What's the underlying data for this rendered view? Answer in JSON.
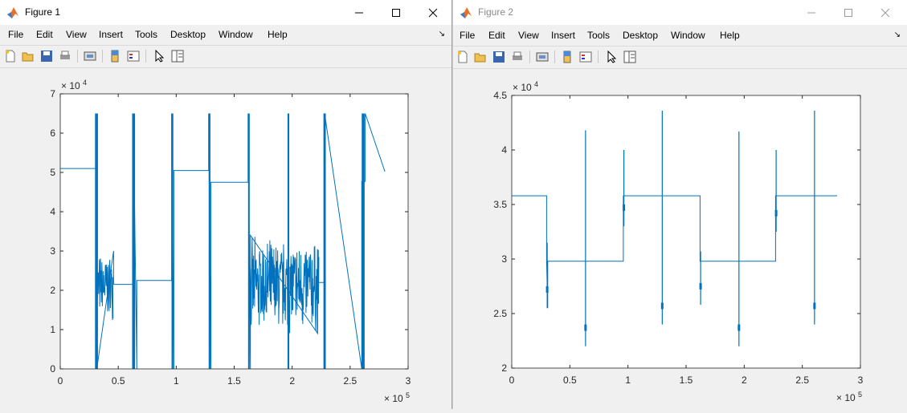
{
  "accent_color": "#0072bd",
  "menu_labels": [
    "File",
    "Edit",
    "View",
    "Insert",
    "Tools",
    "Desktop",
    "Window",
    "Help"
  ],
  "windows": [
    {
      "title": "Figure 1",
      "active": true,
      "chart_data": {
        "type": "line",
        "title": "",
        "xlabel": "",
        "ylabel": "",
        "xlim": [
          0,
          300000
        ],
        "ylim": [
          0,
          70000
        ],
        "x_exponent_label": "10",
        "x_exponent": "5",
        "y_exponent_label": "10",
        "y_exponent": "4",
        "xticks": [
          "0",
          "0.5",
          "1",
          "1.5",
          "2",
          "2.5",
          "3"
        ],
        "yticks": [
          "0",
          "1",
          "2",
          "3",
          "4",
          "5",
          "6",
          "7"
        ],
        "grid": false,
        "series": [
          {
            "x": [
              0,
              31000,
              31000,
              31500,
              46000,
              46000,
              46500,
              63000,
              63000,
              66000,
              66000,
              96000,
              96000,
              98000,
              98000,
              128000,
              128000,
              130000,
              130000,
              162000,
              162000,
              164000,
              164000,
              222000,
              222000,
              228000,
              228000,
              260000,
              260000,
              263000,
              263000,
              280000
            ],
            "y": [
              51000,
              51000,
              65000,
              0,
              30000,
              21500,
              21500,
              21500,
              65000,
              0,
              22500,
              22500,
              65000,
              0,
              50500,
              50500,
              65000,
              0,
              47500,
              47500,
              65000,
              0,
              34000,
              9000,
              22000,
              22000,
              65000,
              0,
              47700,
              47700,
              65000,
              50200
            ]
          }
        ]
      }
    },
    {
      "title": "Figure 2",
      "active": false,
      "chart_data": {
        "type": "line",
        "title": "",
        "xlabel": "",
        "ylabel": "",
        "xlim": [
          0,
          300000
        ],
        "ylim": [
          20000,
          45000
        ],
        "x_exponent_label": "10",
        "x_exponent": "5",
        "y_exponent_label": "10",
        "y_exponent": "4",
        "xticks": [
          "0",
          "0.5",
          "1",
          "1.5",
          "2",
          "2.5",
          "3"
        ],
        "yticks": [
          "2",
          "2.5",
          "3",
          "3.5",
          "4",
          "4.5"
        ],
        "grid": false,
        "series": [
          {
            "x": [
              0,
              30000,
              30000,
              31000,
              31000,
              62000,
              62000,
              96000,
              96000,
              129000,
              129000,
              162000,
              162000,
              196000,
              196000,
              227000,
              227000,
              261000,
              261000,
              280000
            ],
            "y": [
              35800,
              35800,
              29800,
              25500,
              29800,
              29800,
              29800,
              29800,
              35800,
              35800,
              35800,
              35800,
              29800,
              29800,
              29800,
              29800,
              35800,
              35800,
              35800,
              35800
            ]
          }
        ],
        "spikes": [
          {
            "x": 30500,
            "y_low": 25500,
            "y_high": 31500
          },
          {
            "x": 63500,
            "y_low": 22000,
            "y_high": 41800
          },
          {
            "x": 96500,
            "y_low": 33000,
            "y_high": 40000
          },
          {
            "x": 129500,
            "y_low": 24000,
            "y_high": 43600
          },
          {
            "x": 162500,
            "y_low": 25800,
            "y_high": 30700
          },
          {
            "x": 195500,
            "y_low": 22000,
            "y_high": 41700
          },
          {
            "x": 227500,
            "y_low": 32500,
            "y_high": 40000
          },
          {
            "x": 260500,
            "y_low": 24000,
            "y_high": 43600
          }
        ]
      }
    }
  ]
}
